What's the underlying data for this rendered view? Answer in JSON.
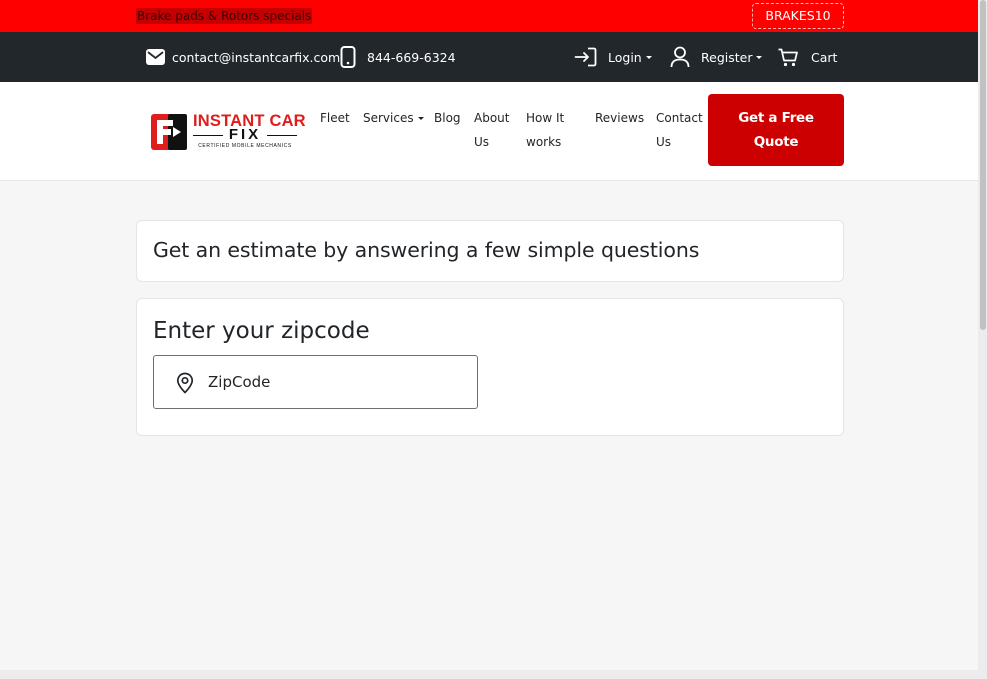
{
  "promo": {
    "text": "Brake pads & Rotors specials",
    "code": "BRAKES10"
  },
  "topbar": {
    "email": "contact@instantcarfix.com",
    "phone": "844-669-6324",
    "login": "Login",
    "register": "Register",
    "cart": "Cart"
  },
  "logo": {
    "line1": "INSTANT CAR",
    "line2": "FIX",
    "tagline": "CERTIFIED MOBILE MECHANICS"
  },
  "nav": {
    "fleet": "Fleet",
    "services": "Services",
    "blog": "Blog",
    "about_1": "About",
    "about_2": "Us",
    "how_1": "How It",
    "how_2": "works",
    "reviews": "Reviews",
    "contact_1": "Contact",
    "contact_2": "Us",
    "cta_1": "Get a Free",
    "cta_2": "Quote"
  },
  "main": {
    "estimate_heading": "Get an estimate by answering a few simple questions",
    "zip_heading": "Enter your zipcode",
    "zip_placeholder": "ZipCode",
    "zip_value": ""
  },
  "colors": {
    "promo_bg": "#ff0000",
    "topbar_bg": "#22272b",
    "brand_red": "#cc0000",
    "page_bg": "#f6f6f7"
  },
  "icons": {
    "email": "envelope-icon",
    "phone": "mobile-phone-icon",
    "login": "sign-in-icon",
    "register": "user-icon",
    "cart": "cart-icon",
    "zip": "map-pin-icon"
  }
}
